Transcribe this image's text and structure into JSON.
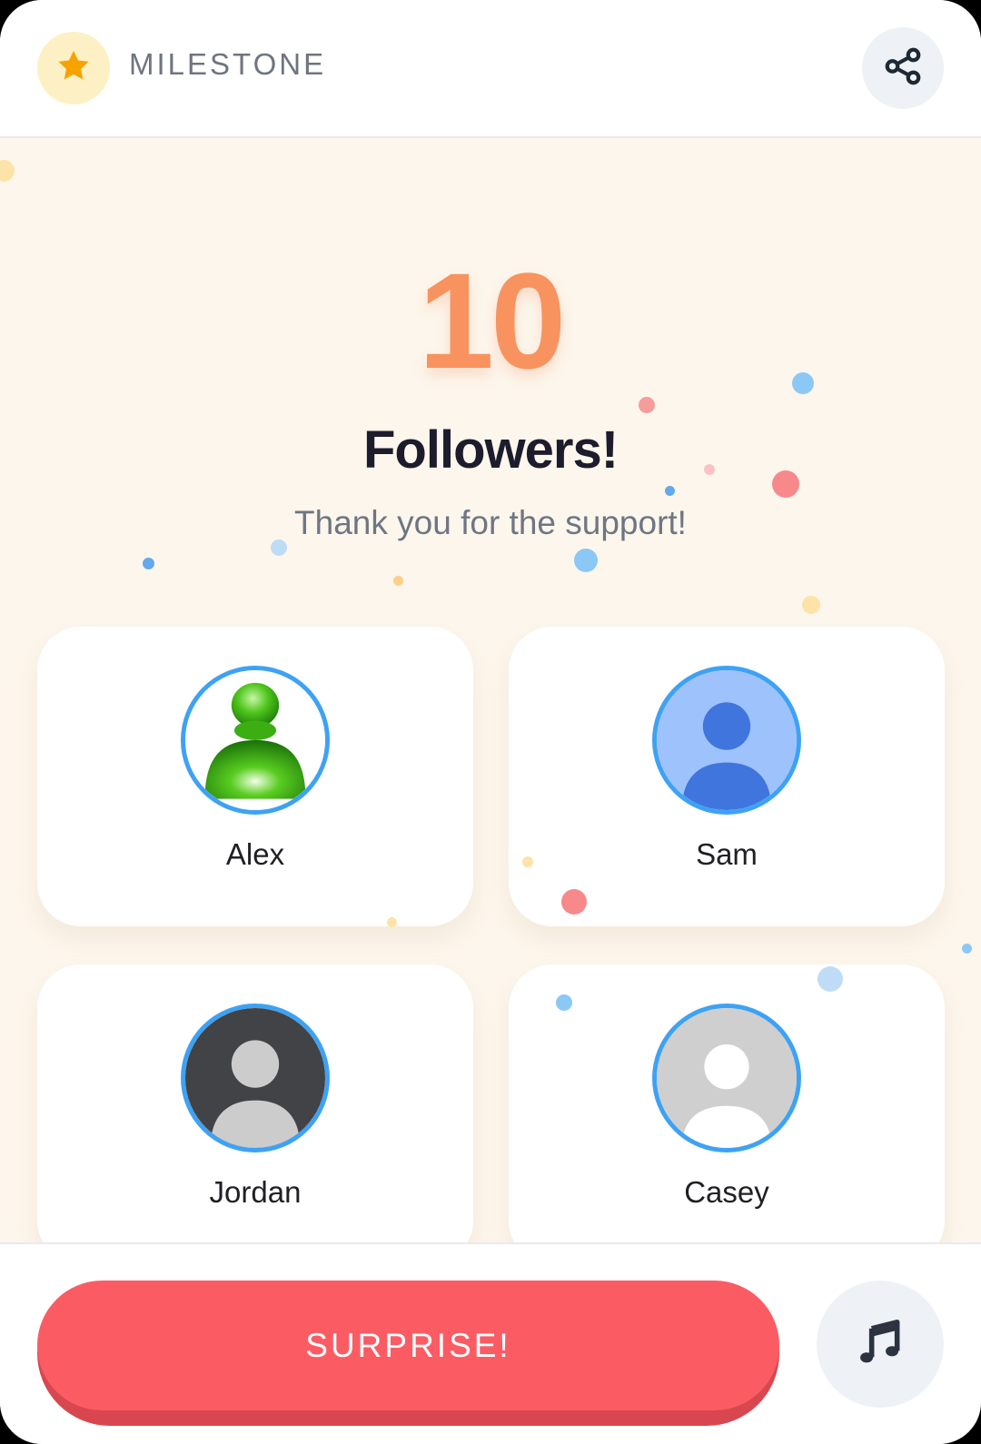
{
  "header": {
    "icon": "star-icon",
    "title": "MILESTONE",
    "share_icon": "share-icon"
  },
  "milestone": {
    "count": "10",
    "headline": "Followers!",
    "message": "Thank you for the support!"
  },
  "followers": [
    {
      "name": "Alex",
      "avatar": "green-person-avatar"
    },
    {
      "name": "Sam",
      "avatar": "blue-person-avatar"
    },
    {
      "name": "Jordan",
      "avatar": "dark-person-avatar"
    },
    {
      "name": "Casey",
      "avatar": "gray-person-avatar"
    }
  ],
  "footer": {
    "surprise_label": "SURPRISE!",
    "music_icon": "music-note-icon"
  },
  "colors": {
    "accent_orange": "#f8935f",
    "surprise_red": "#fb5c64",
    "avatar_ring": "#3ea2f4",
    "background": "#fdf6ec"
  }
}
